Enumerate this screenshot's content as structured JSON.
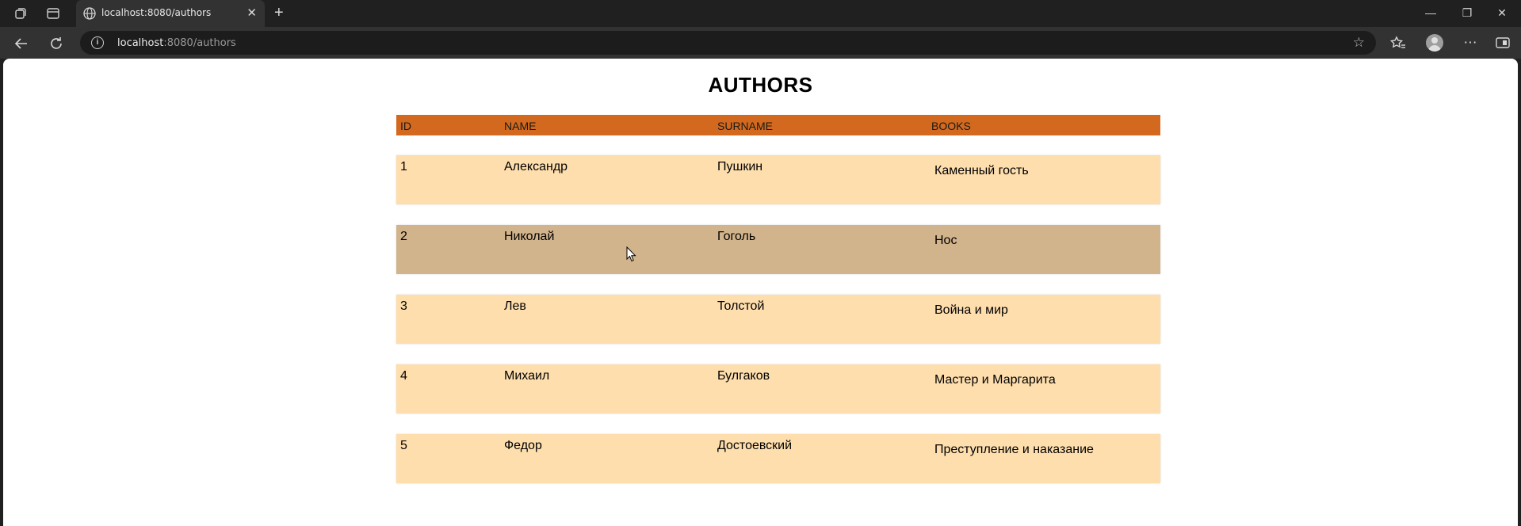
{
  "browser": {
    "tab_title": "localhost:8080/authors",
    "tab_close": "✕",
    "new_tab": "+",
    "url_host": "localhost",
    "url_rest": ":8080/authors",
    "window_buttons": {
      "minimize": "—",
      "maximize": "❐",
      "close": "✕"
    }
  },
  "page": {
    "title": "AUTHORS",
    "columns": {
      "id": "ID",
      "name": "NAME",
      "surname": "SURNAME",
      "books": "BOOKS"
    },
    "rows": [
      {
        "id": "1",
        "name": "Александр",
        "surname": "Пушкин",
        "books": "Каменный гость"
      },
      {
        "id": "2",
        "name": "Николай",
        "surname": "Гоголь",
        "books": "Нос"
      },
      {
        "id": "3",
        "name": "Лев",
        "surname": "Толстой",
        "books": "Война и мир"
      },
      {
        "id": "4",
        "name": "Михаил",
        "surname": "Булгаков",
        "books": "Мастер и Маргарита"
      },
      {
        "id": "5",
        "name": "Федор",
        "surname": "Достоевский",
        "books": "Преступление и наказание"
      }
    ],
    "hovered_row": "2"
  },
  "colors": {
    "header_bg": "#d2691e",
    "row_bg": "#fedead",
    "row_hover_bg": "#d2b48c"
  },
  "icons": {
    "workspaces": "workspaces-icon",
    "tab_actions": "tab-actions-icon",
    "back": "back-arrow-icon",
    "reload": "reload-icon",
    "info": "info-icon",
    "favorite": "star-icon",
    "favorites": "favorites-icon",
    "profile": "profile-icon",
    "menu": "more-icon",
    "sidebar": "sidebar-icon"
  }
}
